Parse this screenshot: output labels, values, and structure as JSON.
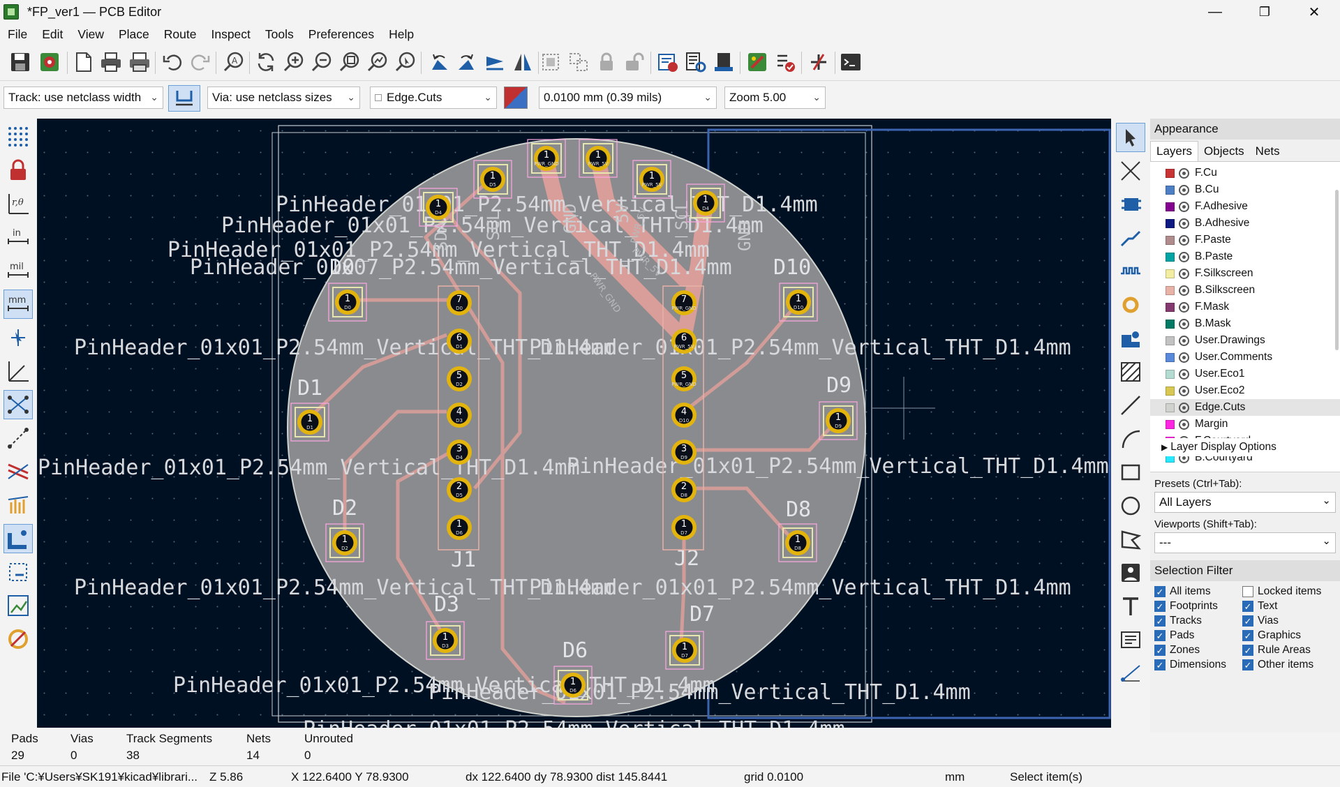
{
  "window": {
    "title": "*FP_ver1 — PCB Editor",
    "minimize": "—",
    "maximize": "❐",
    "close": "✕"
  },
  "menu": [
    "File",
    "Edit",
    "View",
    "Place",
    "Route",
    "Inspect",
    "Tools",
    "Preferences",
    "Help"
  ],
  "toolbar": {
    "icons": [
      "save-icon",
      "board-setup-icon",
      "page-settings-icon",
      "print-icon",
      "plot-icon",
      "undo-icon",
      "redo-icon",
      "find-icon",
      "redraw-icon",
      "zoom-in-icon",
      "zoom-out-icon",
      "zoom-fit-icon",
      "zoom-objects-icon",
      "zoom-selection-icon",
      "rotate-ccw-icon",
      "rotate-cw-icon",
      "flip-icon",
      "mirror-icon",
      "group-icon",
      "ungroup-icon",
      "lock-icon",
      "unlock-icon",
      "netlist-update-icon",
      "footprint-editor-icon",
      "footprint-browser-icon",
      "scripting-icon",
      "drc-icon",
      "router-icon",
      "console-icon"
    ]
  },
  "aux": {
    "track": "Track: use netclass width",
    "via": "Via: use netclass sizes",
    "layer": "Edge.Cuts",
    "grid": "0.0100 mm (0.39 mils)",
    "zoom": "Zoom 5.00"
  },
  "canvas": {
    "refs": [
      "D0",
      "D1",
      "D2",
      "D3",
      "D6",
      "D7",
      "D8",
      "D9",
      "D10",
      "J1",
      "J2"
    ],
    "values": [
      "PinHeader_01x01_P2.54mm_Vertical_THT_D1.4mm",
      "PinHeader_01x07_P2.54mm_Vertical_THT_D1.4mm"
    ],
    "silk": [
      "SDA",
      "SCL",
      "GND",
      "5V",
      "SCL",
      "GND",
      "PWR_5V",
      "PWR_GND",
      "PWR_5V"
    ],
    "pad_nums": [
      "1",
      "2",
      "3",
      "4",
      "5",
      "6",
      "7"
    ],
    "pad_nets": [
      "D0",
      "D1",
      "D2",
      "D3",
      "D4",
      "D5",
      "D6",
      "D7",
      "D8",
      "D9",
      "D10",
      "PWR_GND",
      "PWR_5V"
    ]
  },
  "layers": [
    {
      "name": "F.Cu",
      "color": "#c83434"
    },
    {
      "name": "B.Cu",
      "color": "#4d7fc4"
    },
    {
      "name": "F.Adhesive",
      "color": "#84008f"
    },
    {
      "name": "B.Adhesive",
      "color": "#0c1a82"
    },
    {
      "name": "F.Paste",
      "color": "#b08c8c"
    },
    {
      "name": "B.Paste",
      "color": "#00a3a3"
    },
    {
      "name": "F.Silkscreen",
      "color": "#f2eda1"
    },
    {
      "name": "B.Silkscreen",
      "color": "#e8b2a7"
    },
    {
      "name": "F.Mask",
      "color": "#843a6e"
    },
    {
      "name": "B.Mask",
      "color": "#037a66"
    },
    {
      "name": "User.Drawings",
      "color": "#c2c2c2"
    },
    {
      "name": "User.Comments",
      "color": "#5989db"
    },
    {
      "name": "User.Eco1",
      "color": "#b4dbd2"
    },
    {
      "name": "User.Eco2",
      "color": "#d8c852"
    },
    {
      "name": "Edge.Cuts",
      "color": "#d0d2cd"
    },
    {
      "name": "Margin",
      "color": "#ff26e2"
    },
    {
      "name": "F.Courtyard",
      "color": "#ff26e2"
    },
    {
      "name": "B.Courtyard",
      "color": "#26e9ff"
    }
  ],
  "appearance": {
    "title": "Appearance",
    "tabs": [
      "Layers",
      "Objects",
      "Nets"
    ],
    "layer_display": "Layer Display Options",
    "presets_label": "Presets (Ctrl+Tab):",
    "presets_value": "All Layers",
    "viewports_label": "Viewports (Shift+Tab):",
    "viewports_value": "---",
    "selection_title": "Selection Filter",
    "filters": [
      {
        "label": "All items",
        "checked": true
      },
      {
        "label": "Locked items",
        "checked": false
      },
      {
        "label": "Footprints",
        "checked": true
      },
      {
        "label": "Text",
        "checked": true
      },
      {
        "label": "Tracks",
        "checked": true
      },
      {
        "label": "Vias",
        "checked": true
      },
      {
        "label": "Pads",
        "checked": true
      },
      {
        "label": "Graphics",
        "checked": true
      },
      {
        "label": "Zones",
        "checked": true
      },
      {
        "label": "Rule Areas",
        "checked": true
      },
      {
        "label": "Dimensions",
        "checked": true
      },
      {
        "label": "Other items",
        "checked": true
      }
    ]
  },
  "info": {
    "pads_l": "Pads",
    "pads_v": "29",
    "vias_l": "Vias",
    "vias_v": "0",
    "tracks_l": "Track Segments",
    "tracks_v": "38",
    "nets_l": "Nets",
    "nets_v": "14",
    "unrouted_l": "Unrouted",
    "unrouted_v": "0"
  },
  "status": {
    "file": "File 'C:¥Users¥SK191¥kicad¥librari...",
    "z": "Z 5.86",
    "xy": "X 122.6400  Y 78.9300",
    "delta": "dx 122.6400  dy 78.9300  dist 145.8441",
    "grid": "grid 0.0100",
    "units": "mm",
    "mode": "Select item(s)"
  }
}
